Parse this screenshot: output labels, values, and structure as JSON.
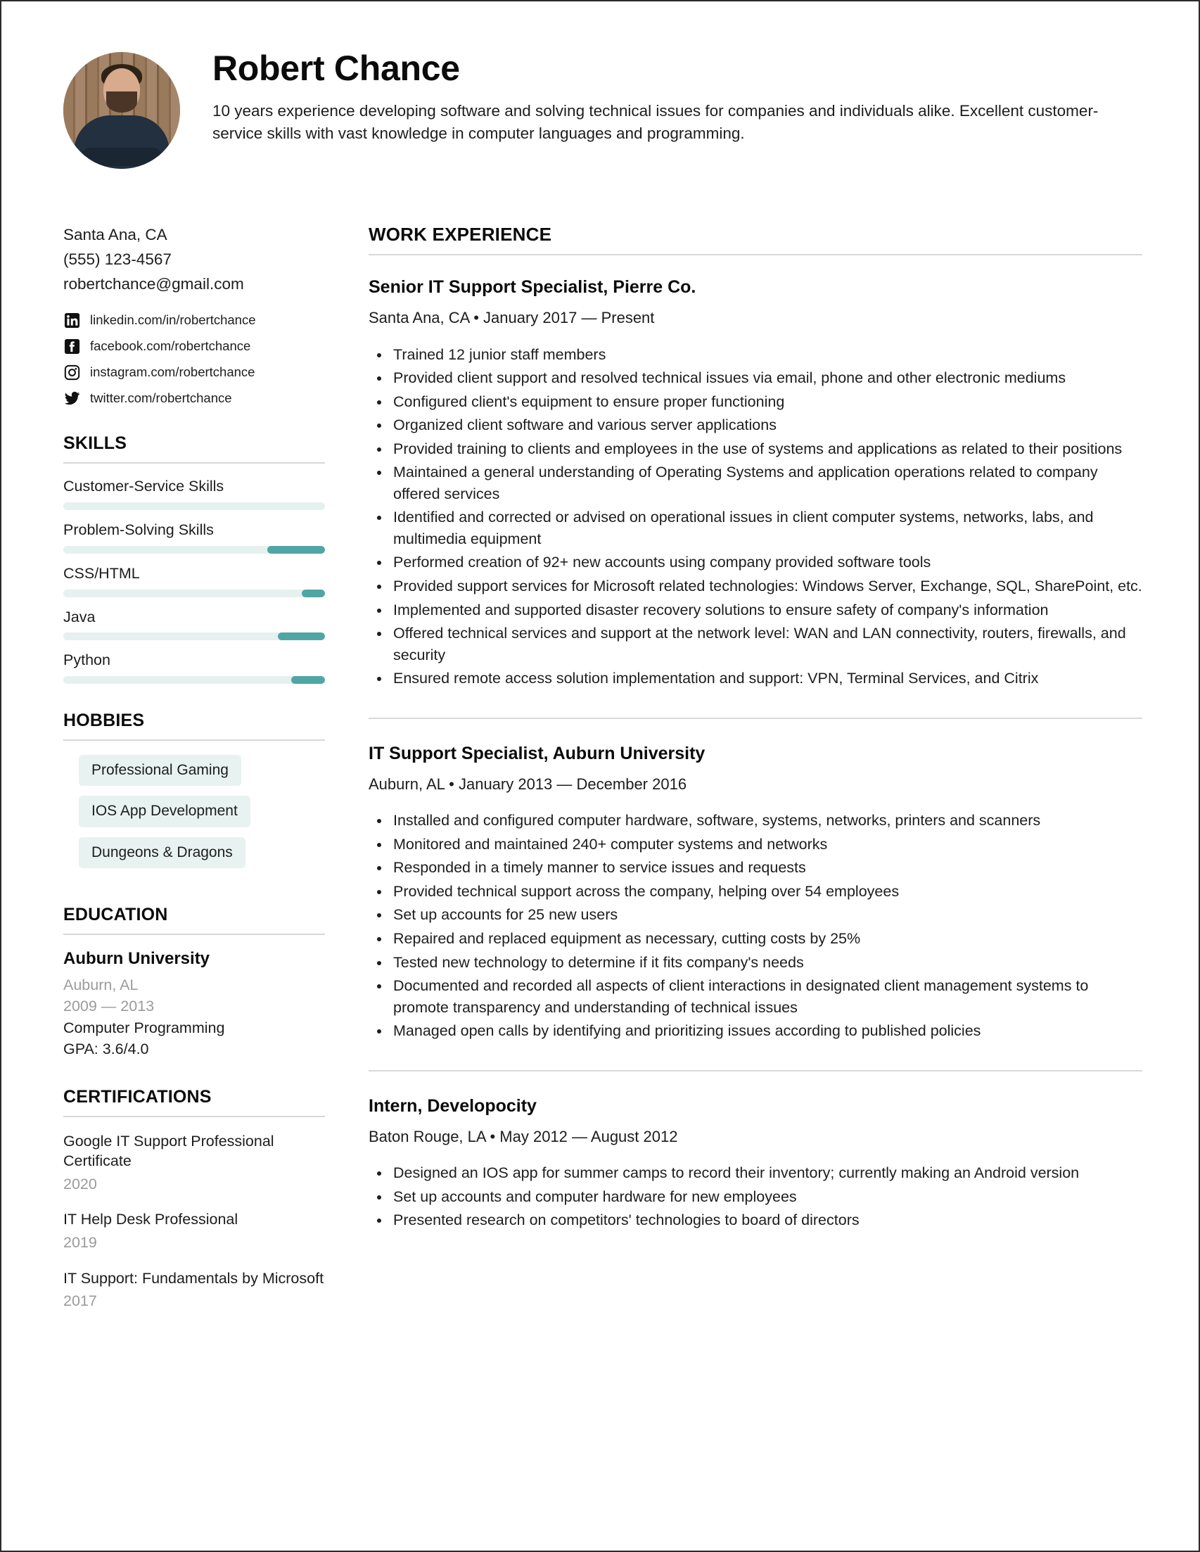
{
  "header": {
    "name": "Robert Chance",
    "summary": "10 years experience developing software and solving technical issues for companies and individuals alike. Excellent customer-service skills with vast knowledge in computer languages and programming.",
    "avatar": "profile-photo"
  },
  "colors": {
    "accent_teal": "#50a5a5",
    "accent_light": "#e4f1ef",
    "chip_bg": "#e8f3f1",
    "rule": "#d8d8d8",
    "muted_text": "#9b9b9b",
    "body_text": "#1d1d1d",
    "page_border": "#2b2b2b"
  },
  "sidebar": {
    "contact": {
      "location": "Santa Ana, CA",
      "phone": "(555) 123-4567",
      "email": "robertchance@gmail.com"
    },
    "social": [
      {
        "icon": "linkedin-icon",
        "label": "linkedin.com/in/robertchance"
      },
      {
        "icon": "facebook-icon",
        "label": "facebook.com/robertchance"
      },
      {
        "icon": "instagram-icon",
        "label": "instagram.com/robertchance"
      },
      {
        "icon": "twitter-icon",
        "label": "twitter.com/robertchance"
      }
    ],
    "skills": {
      "title": "SKILLS",
      "items": [
        {
          "name": "Customer-Service Skills",
          "fill_percent": 0
        },
        {
          "name": "Problem-Solving Skills",
          "fill_percent": 22
        },
        {
          "name": "CSS/HTML",
          "fill_percent": 9
        },
        {
          "name": "Java",
          "fill_percent": 18
        },
        {
          "name": "Python",
          "fill_percent": 13
        }
      ]
    },
    "hobbies": {
      "title": "HOBBIES",
      "items": [
        "Professional Gaming",
        "IOS App Development",
        "Dungeons & Dragons"
      ]
    },
    "education": {
      "title": "EDUCATION",
      "school": "Auburn University",
      "location": "Auburn, AL",
      "years": "2009 — 2013",
      "program": "Computer Programming",
      "gpa": "GPA: 3.6/4.0"
    },
    "certifications": {
      "title": "CERTIFICATIONS",
      "items": [
        {
          "name": "Google IT Support Professional Certificate",
          "year": "2020"
        },
        {
          "name": "IT Help Desk Professional",
          "year": "2019"
        },
        {
          "name": "IT Support: Fundamentals by Microsoft",
          "year": "2017"
        }
      ]
    }
  },
  "main": {
    "title": "WORK EXPERIENCE",
    "jobs": [
      {
        "title": "Senior IT Support Specialist, Pierre Co.",
        "meta": "Santa Ana, CA • January 2017 — Present",
        "bullets": [
          "Trained 12 junior staff members",
          "Provided client support and resolved technical issues via email, phone and other electronic mediums",
          "Configured client's equipment to ensure proper functioning",
          "Organized client software and various server applications",
          "Provided training to clients and employees in the use of systems and applications as related to their positions",
          "Maintained a general understanding of Operating Systems and application operations related to company offered services",
          "Identified and corrected or advised on operational issues in client computer systems, networks, labs, and multimedia equipment",
          "Performed creation of 92+ new accounts using company provided software tools",
          "Provided support services for Microsoft related technologies: Windows Server, Exchange, SQL, SharePoint, etc.",
          "Implemented and supported disaster recovery solutions to ensure safety of company's information",
          "Offered technical services and support at the network level: WAN and LAN connectivity, routers, firewalls, and security",
          "Ensured remote access solution implementation and support: VPN, Terminal Services, and Citrix"
        ]
      },
      {
        "title": "IT Support Specialist, Auburn University",
        "meta": "Auburn, AL • January 2013 — December 2016",
        "bullets": [
          "Installed and configured computer hardware, software, systems, networks, printers and scanners",
          "Monitored and maintained 240+ computer systems and networks",
          "Responded in a timely manner to service issues and requests",
          "Provided technical support across the company, helping over 54 employees",
          "Set up accounts for 25 new users",
          "Repaired and replaced equipment as necessary, cutting costs by 25%",
          "Tested new technology to determine if it fits company's needs",
          "Documented and recorded all aspects of client interactions in designated client management systems to promote transparency and understanding of technical issues",
          "Managed open calls by identifying and prioritizing issues according to published policies"
        ]
      },
      {
        "title": "Intern, Developocity",
        "meta": "Baton Rouge, LA • May 2012 — August 2012",
        "bullets": [
          "Designed an IOS app for summer camps to record their inventory; currently making an Android version",
          "Set up accounts and computer hardware for new employees",
          "Presented research on competitors' technologies to board of directors"
        ]
      }
    ]
  }
}
